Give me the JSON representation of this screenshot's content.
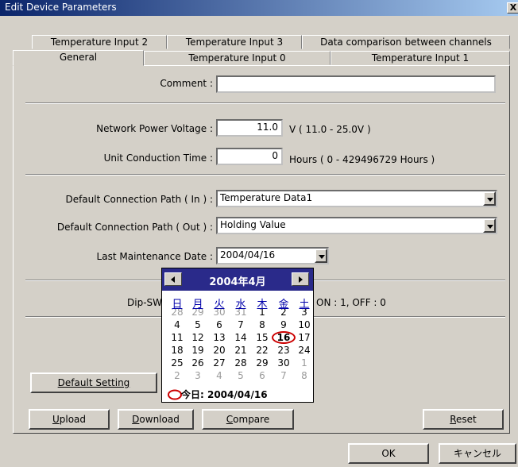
{
  "window": {
    "title": "Edit Device Parameters",
    "close_glyph": "X"
  },
  "tabs": {
    "row1": [
      "Temperature Input 2",
      "Temperature Input 3",
      "Data comparison between channels"
    ],
    "row2": [
      "General",
      "Temperature Input 0",
      "Temperature Input 1"
    ],
    "active": "General"
  },
  "form": {
    "comment_label": "Comment :",
    "comment_value": "",
    "npv_label": "Network Power Voltage :",
    "npv_value": "11.0",
    "npv_unit": "V ( 11.0 - 25.0V )",
    "uct_label": "Unit Conduction Time :",
    "uct_value": "0",
    "uct_unit": "Hours ( 0 - 429496729 Hours )",
    "dcp_in_label": "Default Connection Path ( In ) :",
    "dcp_in_value": "Temperature Data1",
    "dcp_out_label": "Default Connection Path ( Out ) :",
    "dcp_out_value": "Holding Value",
    "lmd_label": "Last Maintenance Date :",
    "lmd_value": "2004/04/16",
    "dipsw_label": "Dip-SW",
    "dipsw_note": "ON : 1, OFF : 0"
  },
  "calendar": {
    "title": "2004年4月",
    "dow": [
      "日",
      "月",
      "火",
      "水",
      "木",
      "金",
      "土"
    ],
    "weeks": [
      [
        "28",
        "29",
        "30",
        "31",
        "1",
        "2",
        "3"
      ],
      [
        "4",
        "5",
        "6",
        "7",
        "8",
        "9",
        "10"
      ],
      [
        "11",
        "12",
        "13",
        "14",
        "15",
        "16",
        "17"
      ],
      [
        "18",
        "19",
        "20",
        "21",
        "22",
        "23",
        "24"
      ],
      [
        "25",
        "26",
        "27",
        "28",
        "29",
        "30",
        "1"
      ],
      [
        "2",
        "3",
        "4",
        "5",
        "6",
        "7",
        "8"
      ]
    ],
    "selected": "16",
    "today_text": "今日: 2004/04/16"
  },
  "buttons": {
    "default_setting": "Default Setting",
    "upload": "Upload",
    "download": "Download",
    "compare": "Compare",
    "reset": "Reset",
    "ok": "OK",
    "cancel": "キャンセル"
  }
}
